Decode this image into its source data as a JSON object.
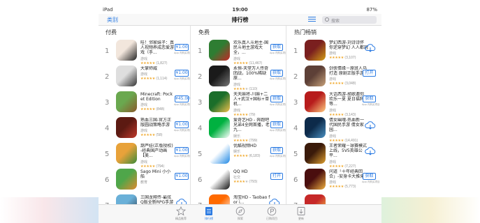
{
  "status": {
    "device": "iPad",
    "time": "19:00",
    "battery": "87%"
  },
  "nav": {
    "back_label": "类别",
    "title": "排行榜",
    "search_placeholder": "搜索"
  },
  "columns": [
    {
      "heading": "付费",
      "apps": [
        {
          "rank": "1",
          "name": "哇！邻家妹子：真人视频养成恋爱游戏（手...",
          "category": "游戏",
          "rating_count": "(1,827)",
          "stars": 4.5,
          "price": "¥1.00",
          "sub": "App 内购买项目",
          "colors": [
            "#f2e6dc",
            "#222222"
          ]
        },
        {
          "rank": "2",
          "name": "大掌师威",
          "category": "游戏",
          "rating_count": "(1,114)",
          "stars": 5,
          "price": "¥1.00",
          "sub": "App 内购买项目",
          "colors": [
            "#dedede",
            "#333333"
          ]
        },
        {
          "rank": "3",
          "name": "Minecraft: Pocket Edition",
          "category": "游戏",
          "rating_count": "(848)",
          "stars": 4.5,
          "price": "¥45.00",
          "sub": "App 内购买项目",
          "colors": [
            "#6aa84f",
            "#8b5a2b"
          ]
        },
        {
          "rank": "4",
          "name": "熟血三国-官方正版圆战策略手游",
          "category": "游戏",
          "rating_count": "(58)",
          "stars": 4.5,
          "price": "¥1.00",
          "sub": "App 内购买项目",
          "colors": [
            "#5c1a12",
            "#c0392b"
          ]
        },
        {
          "rank": "5",
          "name": "葫芦娃(正版授权)-经典国产动画【美...",
          "category": "游戏",
          "rating_count": "(794)",
          "stars": 4.5,
          "price": "¥1.00",
          "sub": "App 内购买项目",
          "colors": [
            "#e8a23a",
            "#3b8b3a"
          ]
        },
        {
          "rank": "6",
          "name": "Sago Mini 小小船",
          "category": "教育",
          "rating_count": "",
          "stars": 0,
          "price": "¥1.00",
          "sub": "",
          "colors": [
            "#4fa64a",
            "#e08a2e"
          ]
        },
        {
          "rank": "7",
          "name": "三国龙翔传-最炫Q版全新RPG手游",
          "category": "游戏",
          "rating_count": "",
          "stars": 0,
          "price": "",
          "sub": "",
          "colors": [
            "#6ab0d8",
            "#2c3e50"
          ]
        }
      ]
    },
    {
      "heading": "免费",
      "apps": [
        {
          "rank": "1",
          "name": "欢乐真人斗地主-国民斗地主游戏大全，...",
          "category": "游戏",
          "rating_count": "(11,467)",
          "stars": 4.5,
          "price": "获取",
          "sub": "App 内购买项目",
          "colors": [
            "#2e7d32",
            "#c62828"
          ]
        },
        {
          "rank": "2",
          "name": "永恒-天堂万人传奇团战，100%稀缺原...",
          "category": "游戏",
          "rating_count": "(110)",
          "stars": 4,
          "price": "获取",
          "sub": "App 内购买项目",
          "colors": [
            "#1a1a1a",
            "#777777"
          ]
        },
        {
          "rank": "3",
          "name": "天天麻将-川麻+二人+武汉+国标+单机...",
          "category": "游戏",
          "rating_count": "(79)",
          "stars": 4.5,
          "price": "获取",
          "sub": "App 内购买项目",
          "colors": [
            "#1b6e2a",
            "#f2c14e"
          ]
        },
        {
          "rank": "4",
          "name": "爱奇艺HD - 奔跑吧兄弟4全网首播，老九...",
          "category": "娱乐",
          "rating_count": "(799)",
          "stars": 4.5,
          "price": "获取",
          "sub": "App 内购买项目",
          "colors": [
            "#00b140",
            "#ffffff"
          ]
        },
        {
          "rank": "5",
          "name": "优酷视频HD",
          "category": "娱乐",
          "rating_count": "(6,183)",
          "stars": 4.5,
          "price": "获取",
          "sub": "App 内购买项目",
          "colors": [
            "#ffffff",
            "#1e88e5"
          ]
        },
        {
          "rank": "6",
          "name": "QQ HD",
          "category": "社交",
          "rating_count": "(793)",
          "stars": 4,
          "price": "打开",
          "sub": "",
          "colors": [
            "#ffffff",
            "#111111"
          ]
        },
        {
          "rank": "7",
          "name": "淘宝HD - Taobao for i...",
          "category": "",
          "rating_count": "",
          "stars": 0,
          "price": "",
          "sub": "",
          "colors": [
            "#ff6a00",
            "#ffffff"
          ]
        }
      ]
    },
    {
      "heading": "热门畅销",
      "apps": [
        {
          "rank": "1",
          "name": "梦幻西游-刘诗诗怀你逆穿梦幻 人人都玩",
          "category": "游戏",
          "rating_count": "(3,107)",
          "stars": 4.5,
          "price": "",
          "sub": "",
          "colors": [
            "#7a1f1f",
            "#d4a017"
          ]
        },
        {
          "rank": "2",
          "name": "剑侠情缘－原班人马打造 原剧正版手游",
          "category": "游戏",
          "rating_count": "(3,048)",
          "stars": 4.5,
          "price": "打开",
          "sub": "",
          "colors": [
            "#5d4037",
            "#c8a27a"
          ]
        },
        {
          "rank": "3",
          "name": "大话西游-胡歌邀你欢乐一夏 夏日福利等...",
          "category": "游戏",
          "rating_count": "(3,143)",
          "stars": 4.5,
          "price": "获取",
          "sub": "App 内购买项目",
          "colors": [
            "#b71c1c",
            "#ffcc80"
          ]
        },
        {
          "rank": "4",
          "name": "倩女幽魂-热血新一代国民手游 倩女家园...",
          "category": "游戏",
          "rating_count": "(14,491)",
          "stars": 4.5,
          "price": "",
          "sub": "",
          "colors": [
            "#0d2a4a",
            "#4a90c2"
          ]
        },
        {
          "rank": "5",
          "name": "王者荣耀－球赛模式上线，5V5英雄公平...",
          "category": "游戏",
          "rating_count": "(7,227)",
          "stars": 4.5,
          "price": "",
          "sub": "",
          "colors": [
            "#3a1a0a",
            "#e0a030"
          ]
        },
        {
          "rank": "6",
          "name": "问道「十年经典回合」-安身卡大推来...",
          "category": "游戏",
          "rating_count": "(5,773)",
          "stars": 4.5,
          "price": "获取",
          "sub": "App 内购买项目",
          "colors": [
            "#4a0e0e",
            "#f0b040"
          ]
        },
        {
          "rank": "7",
          "name": "",
          "category": "",
          "rating_count": "",
          "stars": 0,
          "price": "",
          "sub": "",
          "colors": [
            "#c62828",
            "#ffd54f"
          ]
        }
      ]
    }
  ],
  "tabs": [
    {
      "label": "精品推荐",
      "icon": "star-icon",
      "active": false
    },
    {
      "label": "排行榜",
      "icon": "ranking-icon",
      "active": true
    },
    {
      "label": "探索",
      "icon": "compass-icon",
      "active": false
    },
    {
      "label": "已购项目",
      "icon": "purchased-icon",
      "active": false
    },
    {
      "label": "更新",
      "icon": "updates-icon",
      "active": false
    }
  ],
  "accent": "#2a7ae2"
}
